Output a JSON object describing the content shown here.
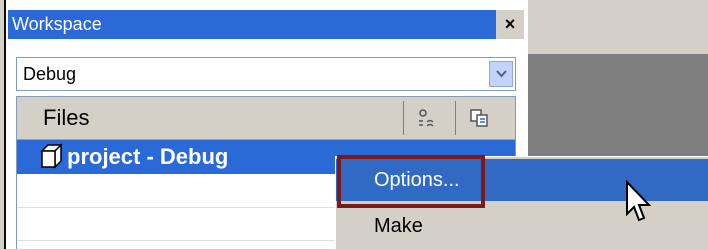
{
  "workspace": {
    "title": "Workspace",
    "close_symbol": "×",
    "config_select": {
      "value": "Debug"
    }
  },
  "files": {
    "header": "Files",
    "project": "project - Debug"
  },
  "context_menu": {
    "items": [
      {
        "label": "Options...",
        "active": true
      },
      {
        "label": "Make",
        "active": false
      }
    ]
  },
  "colors": {
    "title_bar": "#2a69d6",
    "selection": "#316ac5",
    "highlight_border": "#7a1a1a",
    "face": "#d4d0c8"
  },
  "icons": [
    "close-icon",
    "dropdown-arrow-icon",
    "header-options-icon",
    "header-files-icon",
    "project-cube-icon",
    "mouse-cursor-icon"
  ]
}
